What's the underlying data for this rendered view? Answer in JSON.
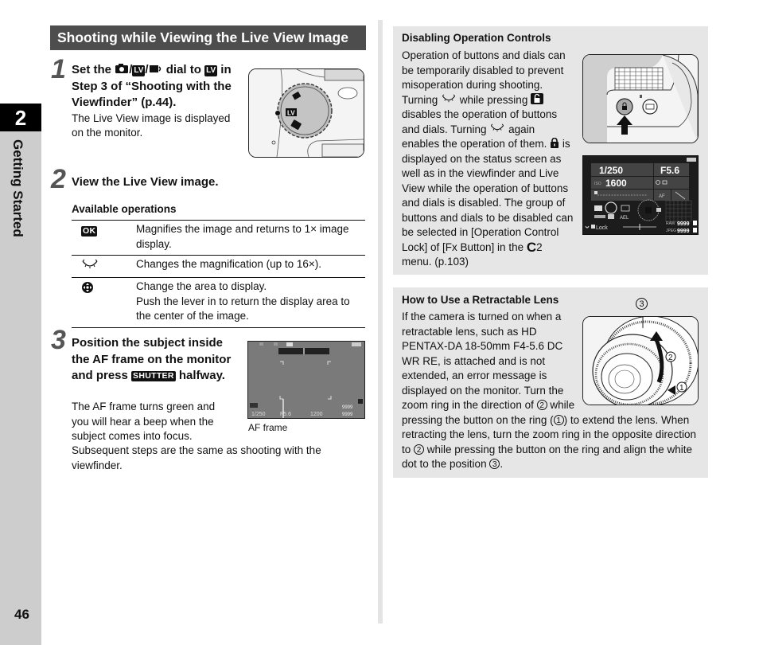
{
  "sidebar": {
    "chapter_number": "2",
    "chapter_title": "Getting Started",
    "page_number": "46"
  },
  "section": {
    "title": "Shooting while Viewing the Live View Image"
  },
  "steps": [
    {
      "number": "1",
      "title_parts": [
        "Set the ",
        "/",
        "/",
        " dial to ",
        " in Step 3 of “Shooting with the Viewfinder” (p.44)."
      ],
      "icons": [
        "camera-icon",
        "lv-icon",
        "movie-icon",
        "lv-icon"
      ],
      "lv_label": "LV",
      "body": "The Live View image is displayed on the monitor."
    },
    {
      "number": "2",
      "title": "View the Live View image."
    },
    {
      "number": "3",
      "title_before": "Position the subject inside the AF frame on the monitor and press ",
      "shutter_label": "SHUTTER",
      "title_after": " halfway.",
      "body": "The AF frame turns green and you will hear a beep when the subject comes into focus.",
      "body2": "Subsequent steps are the same as shooting with the viewfinder.",
      "figure_caption": "AF frame"
    }
  ],
  "operations": {
    "title": "Available operations",
    "rows": [
      {
        "icon": "ok-button-icon",
        "icon_label": "OK",
        "desc": "Magnifies the image and returns to 1× image display."
      },
      {
        "icon": "rear-dial-icon",
        "desc": "Changes the magnification (up to 16×)."
      },
      {
        "icon": "four-way-lever-icon",
        "desc": "Change the area to display.",
        "desc2": "Push the lever in to return the display area to the center of the image."
      }
    ]
  },
  "lcd_af": {
    "shutter": "1/250",
    "aperture": "F5.6",
    "iso": "1200",
    "raw_count": "9999",
    "jpeg_count": "9999"
  },
  "note_disable": {
    "title": "Disabling Operation Controls",
    "p1": "Operation of buttons and dials can be temporarily disabled to prevent misoperation during shooting.",
    "p2a": "Turning ",
    "p2b": " while pressing ",
    "p2c": " disables the operation of buttons and dials. Turning ",
    "p2d": " again enables the operation of them.",
    "p3": " is displayed on the status screen as well as in the viewfinder and Live View while the operation of buttons and dials is disabled.",
    "p4a": "The group of buttons and dials to be disabled can be selected in [Operation Control Lock] of [Fx Button] in the ",
    "p4_menu_letter": "C",
    "p4b": "2 menu. (p.103)",
    "status_screen": {
      "shutter": "1/250",
      "aperture": "F5.6",
      "iso": "1600",
      "lock_label": "Lock",
      "raw_label": "RAW",
      "jpeg_label": "JPEG",
      "raw_count": "9999",
      "jpeg_count": "9999",
      "ael_label": "AEL",
      "af_label": "AF"
    }
  },
  "note_lens": {
    "title": "How to Use a Retractable Lens",
    "p_a": "If the camera is turned on when a retractable lens, such as HD PENTAX-DA 18-50mm F4-5.6 DC WR RE, is attached and is not extended, an error message is displayed on the monitor. Turn the zoom ring in the direction of ",
    "p_b": " while pressing the button on the ring (",
    "p_c": ") to extend the lens. When retracting the lens, turn the zoom ring in the opposite direction to ",
    "p_d": " while pressing the button on the ring and align the white dot to the position ",
    "p_e": ".",
    "markers": [
      "1",
      "2",
      "3"
    ]
  }
}
